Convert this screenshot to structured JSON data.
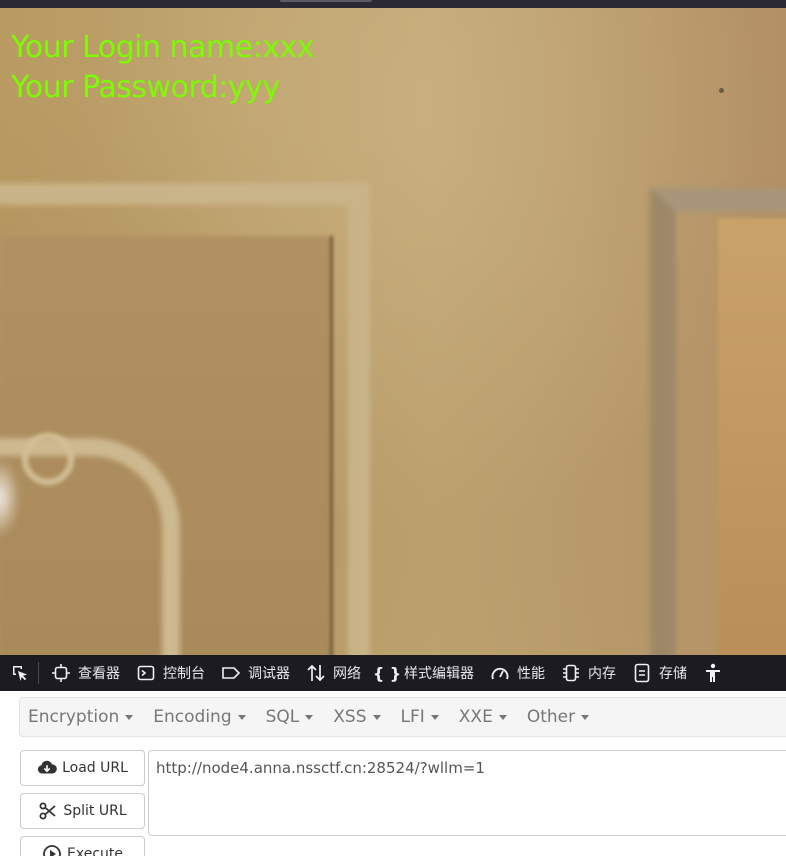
{
  "page": {
    "login_line": "Your Login name:xxx",
    "password_line": "Your Password:yyy",
    "text_color": "#7cfc00"
  },
  "devtools": {
    "items": [
      {
        "icon": "inspector-icon",
        "label": "查看器"
      },
      {
        "icon": "console-icon",
        "label": "控制台"
      },
      {
        "icon": "debugger-icon",
        "label": "调试器"
      },
      {
        "icon": "network-icon",
        "label": "网络"
      },
      {
        "icon": "style-editor-icon",
        "label": "样式编辑器"
      },
      {
        "icon": "performance-icon",
        "label": "性能"
      },
      {
        "icon": "memory-icon",
        "label": "内存"
      },
      {
        "icon": "storage-icon",
        "label": "存储"
      }
    ]
  },
  "hackbar": {
    "menu": [
      "Encryption",
      "Encoding",
      "SQL",
      "XSS",
      "LFI",
      "XXE",
      "Other"
    ],
    "load_url": "Load URL",
    "split_url": "Split URL",
    "execute": "Execute",
    "url_value": "http://node4.anna.nssctf.cn:28524/?wllm=1"
  }
}
